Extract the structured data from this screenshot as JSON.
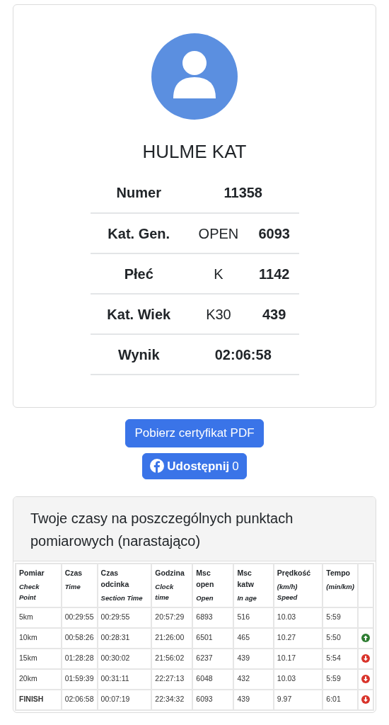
{
  "profile": {
    "name": "HULME KAT"
  },
  "stats": [
    {
      "label": "Numer",
      "value": "11358"
    },
    {
      "label": "Kat. Gen.",
      "category": "OPEN",
      "place": "6093"
    },
    {
      "label": "Płeć",
      "category": "K",
      "place": "1142"
    },
    {
      "label": "Kat. Wiek",
      "category": "K30",
      "place": "439"
    },
    {
      "label": "Wynik",
      "value": "02:06:58"
    }
  ],
  "buttons": {
    "certificate": "Pobierz certyfikat PDF",
    "share": {
      "label": "Udostępnij",
      "count": "0"
    }
  },
  "splits": {
    "title": "Twoje czasy na poszczególnych punktach pomiarowych (narastająco)",
    "columns": [
      {
        "title": "Pomiar",
        "subtitle": "Check Point"
      },
      {
        "title": "Czas",
        "subtitle": "Time"
      },
      {
        "title": "Czas odcinka",
        "subtitle": "Section Time"
      },
      {
        "title": "Godzina",
        "subtitle": "Clock time"
      },
      {
        "title": "Msc open",
        "subtitle": "Open"
      },
      {
        "title": "Msc katw",
        "subtitle": "In age"
      },
      {
        "title": "Prędkość",
        "subtitle": "(km/h) Speed"
      },
      {
        "title": "Tempo",
        "subtitle": "(min/km)"
      }
    ],
    "rows": [
      {
        "bold": false,
        "kind": "first",
        "cells": [
          "5km",
          "00:29:55",
          "00:29:55",
          "20:57:29",
          "6893",
          "516",
          "10.03",
          "5:59"
        ]
      },
      {
        "bold": false,
        "kind": "up",
        "cells": [
          "10km",
          "00:58:26",
          "00:28:31",
          "21:26:00",
          "6501",
          "465",
          "10.27",
          "5:50"
        ]
      },
      {
        "bold": false,
        "kind": "down",
        "cells": [
          "15km",
          "01:28:28",
          "00:30:02",
          "21:56:02",
          "6237",
          "439",
          "10.17",
          "5:54"
        ]
      },
      {
        "bold": false,
        "kind": "down",
        "cells": [
          "20km",
          "01:59:39",
          "00:31:11",
          "22:27:13",
          "6048",
          "432",
          "10.03",
          "5:59"
        ]
      },
      {
        "bold": true,
        "kind": "down",
        "cells": [
          "FINISH",
          "02:06:58",
          "00:07:19",
          "22:34:32",
          "6093",
          "439",
          "9.97",
          "6:01"
        ]
      }
    ]
  }
}
